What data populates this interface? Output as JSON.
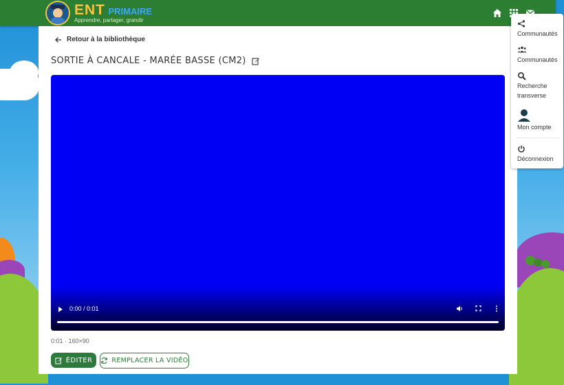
{
  "header": {
    "brand_main": "ENT",
    "brand_sub": "PRIMAIRE",
    "brand_tagline": "Apprendre, partager, grandir",
    "icons": [
      "home-icon",
      "apps-grid-icon",
      "mail-icon"
    ]
  },
  "page": {
    "back_label": "Retour à la bibliothèque",
    "title": "SORTIE À CANCALE - MARÉE BASSE (CM2)",
    "meta": "0:01 · 160×90"
  },
  "video": {
    "time": "0:00 / 0:01",
    "progress": 0,
    "color": "#0000f5"
  },
  "actions": {
    "edit_label": "ÉDITER",
    "replace_label": "REMPLACER LA VIDÉO"
  },
  "menu": {
    "items": [
      {
        "label": "Communautés",
        "icon": "share-icon"
      },
      {
        "label": "Communautés",
        "icon": "group-icon"
      },
      {
        "label": "Recherche transverse",
        "icon": "search-icon"
      },
      {
        "label": "Mon compte",
        "icon": "user-icon"
      },
      {
        "label": "Déconnexion",
        "icon": "power-icon"
      }
    ]
  },
  "colors": {
    "header": "#2b7e32",
    "accent": "#2d7b3c"
  }
}
